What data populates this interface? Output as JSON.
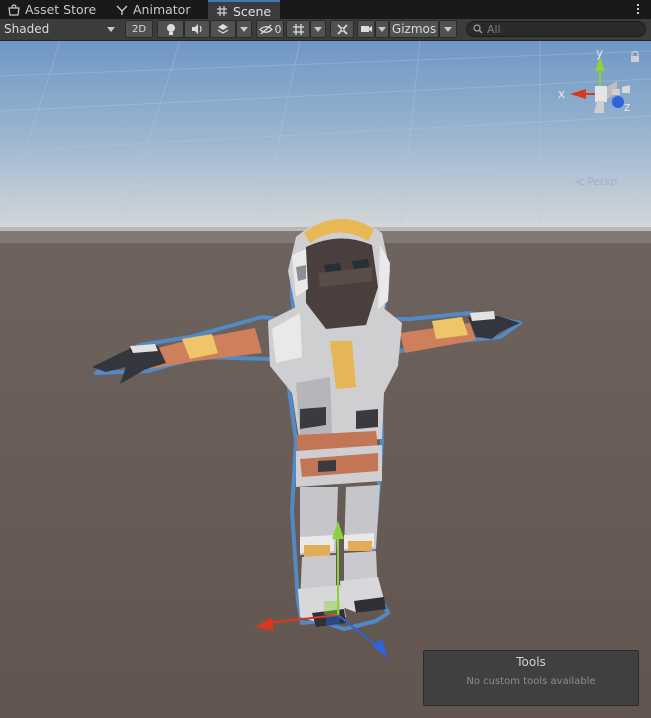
{
  "tabs": [
    {
      "label": "Asset Store",
      "icon": "asset-store-icon",
      "active": false
    },
    {
      "label": "Animator",
      "icon": "animator-icon",
      "active": false
    },
    {
      "label": "Scene",
      "icon": "scene-grid-icon",
      "active": true
    }
  ],
  "toolbar": {
    "draw_mode": "Shaded",
    "mode_2d": "2D",
    "hidden_count": "0",
    "gizmos": "Gizmos",
    "search_placeholder": "All"
  },
  "gizmo": {
    "x": "x",
    "y": "y",
    "z": "z",
    "projection": "Persp"
  },
  "tools_overlay": {
    "title": "Tools",
    "message": "No custom tools available"
  },
  "colors": {
    "selection_outline": "#4f8fd0",
    "axis_x": "#d8391d",
    "axis_y": "#8fd13a",
    "axis_z": "#2f63d9",
    "sky": "#8aa9c9",
    "ground": "#675b56"
  }
}
